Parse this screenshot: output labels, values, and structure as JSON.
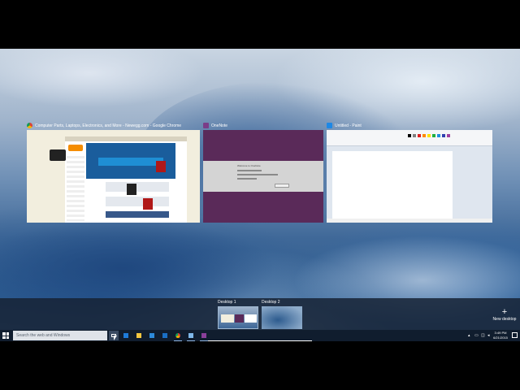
{
  "windows": [
    {
      "title": "Computer Parts, Laptops, Electronics, and More - Newegg.com - Google Chrome",
      "app": "chrome",
      "icon": "chrome-icon",
      "accent": "#f58d00"
    },
    {
      "title": "OneNote",
      "app": "onenote",
      "icon": "onenote-icon",
      "accent": "#7b3d88",
      "dialog_heading": "Welcome to OneNote"
    },
    {
      "title": "Untitled - Paint",
      "app": "paint",
      "icon": "paint-icon",
      "accent": "#1e88e5"
    }
  ],
  "desktops": [
    {
      "label": "Desktop 1",
      "selected": true
    },
    {
      "label": "Desktop 2",
      "selected": false
    }
  ],
  "new_desktop": {
    "symbol": "+",
    "label": "New desktop"
  },
  "taskbar": {
    "search_placeholder": "Search the web and Windows",
    "pinned_apps": [
      "task-view-icon",
      "edge-icon",
      "file-explorer-icon",
      "store-icon",
      "outlook-icon",
      "chrome-icon",
      "paint-icon",
      "onenote-icon"
    ],
    "clock": {
      "time": "3:49 PM",
      "date": "6/21/2015"
    }
  },
  "colors": {
    "taskbar": "#101d2e",
    "strip": "#16223 4",
    "onenote_purple": "#5a2a59"
  }
}
